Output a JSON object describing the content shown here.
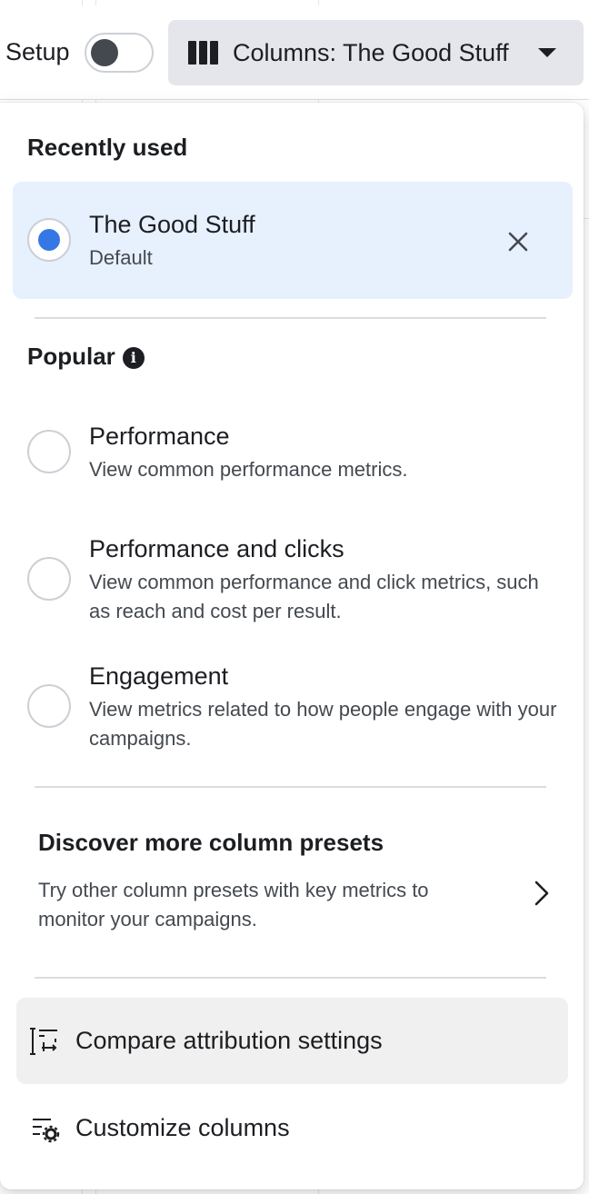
{
  "toolbar": {
    "setup_label": "Setup",
    "setup_toggle_on": false,
    "columns_button_label": "Columns: The Good Stuff"
  },
  "recently_used": {
    "title": "Recently used",
    "items": [
      {
        "title": "The Good Stuff",
        "subtitle": "Default",
        "selected": true
      }
    ]
  },
  "popular": {
    "title": "Popular",
    "items": [
      {
        "title": "Performance",
        "description": "View common performance metrics."
      },
      {
        "title": "Performance and clicks",
        "description": "View common performance and click metrics, such as reach and cost per result."
      },
      {
        "title": "Engagement",
        "description": "View metrics related to how people engage with your campaigns."
      }
    ]
  },
  "discover": {
    "title": "Discover more column presets",
    "description": "Try other column presets with key metrics to monitor your campaigns."
  },
  "menu": {
    "compare_label": "Compare attribution settings",
    "customize_label": "Customize columns"
  },
  "colors": {
    "selected_bg": "#e7f0fd",
    "radio_accent": "#3578e5",
    "toolbar_button_bg": "#e4e6eb"
  }
}
